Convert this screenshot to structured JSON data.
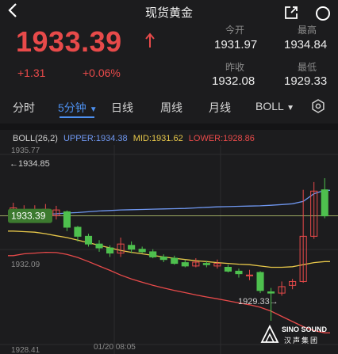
{
  "header": {
    "title": "现货黄金"
  },
  "quote": {
    "price": "1933.39",
    "change": "+1.31",
    "change_pct": "+0.06%",
    "open_label": "今开",
    "open_value": "1931.97",
    "high_label": "最高",
    "high_value": "1934.84",
    "prev_close_label": "昨收",
    "prev_close_value": "1932.08",
    "low_label": "最低",
    "low_value": "1929.33"
  },
  "tabs": [
    {
      "label": "分时"
    },
    {
      "label": "5分钟"
    },
    {
      "label": "日线"
    },
    {
      "label": "周线"
    },
    {
      "label": "月线"
    },
    {
      "label": "BOLL"
    }
  ],
  "legend": {
    "indicator": "BOLL(26,2)",
    "upper": "UPPER:1934.38",
    "mid": "MID:1931.62",
    "lower": "LOWER:1928.86"
  },
  "colors": {
    "up": "#e84a4a",
    "down": "#4ec04e",
    "upper": "#6f97f0",
    "mid": "#e8c84a",
    "lower": "#e84a4a",
    "accent": "#4d90f0"
  },
  "chart_data": {
    "type": "candlestick",
    "ylim": [
      1928.41,
      1935.77
    ],
    "y_top_label": "1935.77",
    "y_mid_label": "1932.09",
    "y_bottom_label": "1928.41",
    "high_marker": "←1934.85",
    "low_marker": "1929.33→",
    "current_price_tag": "1933.39",
    "x_time_label": "01/20 08:05",
    "candles": [
      {
        "o": 1933.4,
        "c": 1933.7,
        "h": 1933.9,
        "l": 1933.2
      },
      {
        "o": 1933.35,
        "c": 1933.6,
        "h": 1933.8,
        "l": 1933.2
      },
      {
        "o": 1933.3,
        "c": 1933.55,
        "h": 1933.8,
        "l": 1933.2
      },
      {
        "o": 1933.45,
        "c": 1933.65,
        "h": 1933.85,
        "l": 1933.3
      },
      {
        "o": 1933.4,
        "c": 1933.62,
        "h": 1933.78,
        "l": 1933.25
      },
      {
        "o": 1933.55,
        "c": 1932.95,
        "h": 1933.6,
        "l": 1932.8
      },
      {
        "o": 1932.95,
        "c": 1932.6,
        "h": 1933.0,
        "l": 1932.4
      },
      {
        "o": 1932.6,
        "c": 1932.3,
        "h": 1932.7,
        "l": 1932.2
      },
      {
        "o": 1932.3,
        "c": 1932.15,
        "h": 1932.45,
        "l": 1932.0
      },
      {
        "o": 1932.15,
        "c": 1931.95,
        "h": 1932.25,
        "l": 1931.8
      },
      {
        "o": 1931.95,
        "c": 1932.3,
        "h": 1932.55,
        "l": 1931.8
      },
      {
        "o": 1932.25,
        "c": 1932.1,
        "h": 1932.4,
        "l": 1931.95
      },
      {
        "o": 1932.1,
        "c": 1932.0,
        "h": 1932.2,
        "l": 1931.95
      },
      {
        "o": 1932.0,
        "c": 1931.8,
        "h": 1932.1,
        "l": 1931.75
      },
      {
        "o": 1931.8,
        "c": 1931.7,
        "h": 1931.9,
        "l": 1931.6
      },
      {
        "o": 1931.75,
        "c": 1931.55,
        "h": 1931.85,
        "l": 1931.5
      },
      {
        "o": 1931.58,
        "c": 1931.45,
        "h": 1931.7,
        "l": 1931.4
      },
      {
        "o": 1931.45,
        "c": 1931.6,
        "h": 1931.75,
        "l": 1931.4
      },
      {
        "o": 1931.55,
        "c": 1931.5,
        "h": 1931.65,
        "l": 1931.4
      },
      {
        "o": 1931.45,
        "c": 1931.55,
        "h": 1931.7,
        "l": 1931.35
      },
      {
        "o": 1931.4,
        "c": 1931.25,
        "h": 1931.5,
        "l": 1931.2
      },
      {
        "o": 1931.25,
        "c": 1931.15,
        "h": 1931.35,
        "l": 1931.0
      },
      {
        "o": 1931.1,
        "c": 1931.1,
        "h": 1931.3,
        "l": 1930.9
      },
      {
        "o": 1931.2,
        "c": 1930.5,
        "h": 1931.25,
        "l": 1930.4
      },
      {
        "o": 1930.45,
        "c": 1930.4,
        "h": 1930.6,
        "l": 1929.33
      },
      {
        "o": 1930.4,
        "c": 1930.65,
        "h": 1930.85,
        "l": 1930.3
      },
      {
        "o": 1930.7,
        "c": 1930.85,
        "h": 1930.95,
        "l": 1930.55
      },
      {
        "o": 1930.85,
        "c": 1932.6,
        "h": 1934.4,
        "l": 1930.8
      },
      {
        "o": 1932.6,
        "c": 1934.35,
        "h": 1934.7,
        "l": 1932.5
      },
      {
        "o": 1934.4,
        "c": 1933.39,
        "h": 1934.85,
        "l": 1933.3
      }
    ],
    "upper": [
      1933.48,
      1933.45,
      1933.44,
      1933.46,
      1933.47,
      1933.5,
      1933.52,
      1933.55,
      1933.58,
      1933.6,
      1933.62,
      1933.63,
      1933.64,
      1933.65,
      1933.66,
      1933.67,
      1933.68,
      1933.7,
      1933.72,
      1933.74,
      1933.75,
      1933.76,
      1933.77,
      1933.78,
      1933.8,
      1933.83,
      1933.86,
      1933.95,
      1934.25,
      1934.38
    ],
    "mid": [
      1932.8,
      1932.78,
      1932.76,
      1932.7,
      1932.62,
      1932.55,
      1932.45,
      1932.35,
      1932.25,
      1932.15,
      1932.05,
      1931.98,
      1931.92,
      1931.86,
      1931.8,
      1931.75,
      1931.7,
      1931.65,
      1931.62,
      1931.58,
      1931.55,
      1931.52,
      1931.5,
      1931.45,
      1931.4,
      1931.4,
      1931.42,
      1931.5,
      1931.58,
      1931.62
    ],
    "lower": [
      1931.85,
      1931.92,
      1931.95,
      1931.98,
      1931.97,
      1931.9,
      1931.78,
      1931.62,
      1931.45,
      1931.28,
      1931.1,
      1930.95,
      1930.82,
      1930.7,
      1930.6,
      1930.5,
      1930.42,
      1930.33,
      1930.25,
      1930.18,
      1930.1,
      1930.02,
      1929.95,
      1929.85,
      1929.7,
      1929.5,
      1929.3,
      1929.1,
      1928.95,
      1928.86
    ]
  },
  "brand": {
    "line1": "SINO SOUND",
    "line2": "汉声集团"
  }
}
